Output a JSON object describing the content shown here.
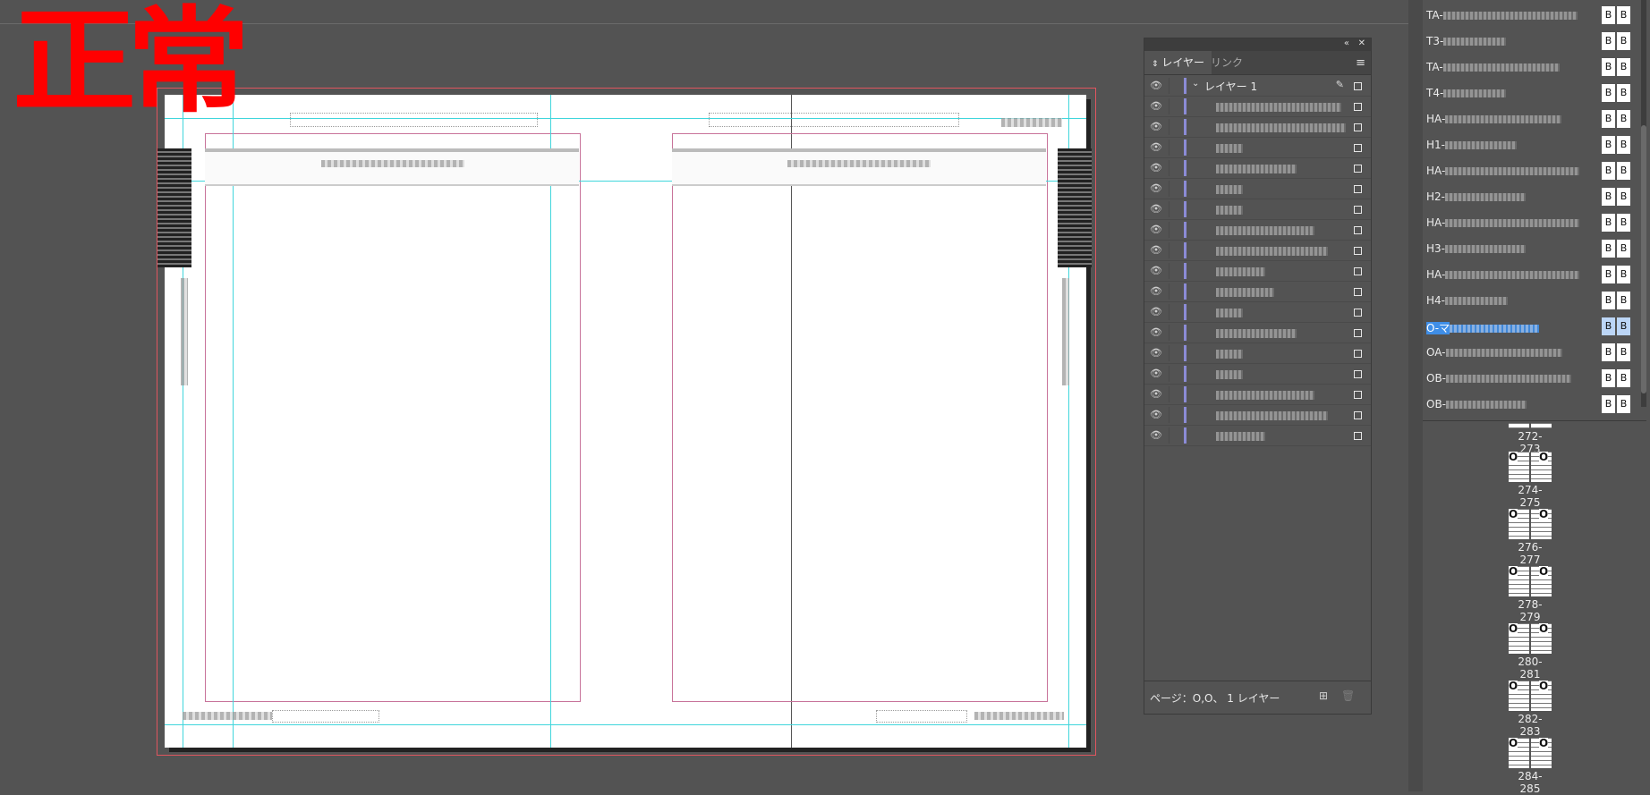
{
  "stamp": "正常",
  "layers_panel": {
    "tab_layers": "レイヤー",
    "tab_links": "リンク",
    "collapse_glyph": "«",
    "close_glyph": "✕",
    "parent_layer": "レイヤー 1",
    "footer_info": "ページ：O,O、 1 レイヤー"
  },
  "pages_panel": {
    "masters": [
      {
        "prefix": "TA-",
        "b1": "B",
        "b2": "B"
      },
      {
        "prefix": "T3-",
        "b1": "B",
        "b2": "B"
      },
      {
        "prefix": "TA-",
        "b1": "B",
        "b2": "B"
      },
      {
        "prefix": "T4-",
        "b1": "B",
        "b2": "B"
      },
      {
        "prefix": "HA-",
        "b1": "B",
        "b2": "B"
      },
      {
        "prefix": "H1-",
        "b1": "B",
        "b2": "B"
      },
      {
        "prefix": "HA-",
        "b1": "B",
        "b2": "B"
      },
      {
        "prefix": "H2-",
        "b1": "B",
        "b2": "B"
      },
      {
        "prefix": "HA-",
        "b1": "B",
        "b2": "B"
      },
      {
        "prefix": "H3-",
        "b1": "B",
        "b2": "B"
      },
      {
        "prefix": "HA-",
        "b1": "B",
        "b2": "B"
      },
      {
        "prefix": "H4-",
        "b1": "B",
        "b2": "B"
      },
      {
        "prefix": "O-マ",
        "b1": "B",
        "b2": "B"
      },
      {
        "prefix": "OA-",
        "b1": "B",
        "b2": "B"
      },
      {
        "prefix": "OB-",
        "b1": "B",
        "b2": "B"
      },
      {
        "prefix": "OB-",
        "b1": "B",
        "b2": "B"
      }
    ],
    "spreads": [
      {
        "label": "272-273",
        "mark": ""
      },
      {
        "label": "274-275",
        "mark": "O"
      },
      {
        "label": "276-277",
        "mark": "O"
      },
      {
        "label": "278-279",
        "mark": "O"
      },
      {
        "label": "280-281",
        "mark": "O"
      },
      {
        "label": "282-283",
        "mark": "O"
      },
      {
        "label": "284-285",
        "mark": "O"
      }
    ]
  }
}
